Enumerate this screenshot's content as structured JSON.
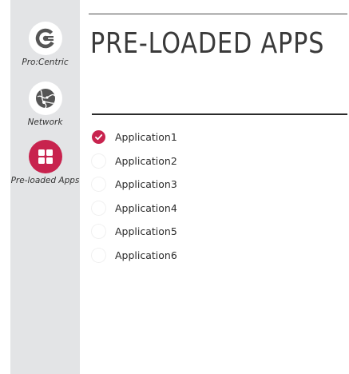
{
  "sidebar": {
    "items": [
      {
        "label": "Pro:Centric",
        "icon": "procentric-logo-icon",
        "color": "#ffffff"
      },
      {
        "label": "Network",
        "icon": "globe-icon",
        "color": "#ffffff"
      },
      {
        "label": "Pre-loaded Apps",
        "icon": "apps-grid-icon",
        "color": "#c8234e",
        "active": true
      }
    ]
  },
  "main": {
    "title": "PRE-LOADED APPS",
    "apps": [
      {
        "label": "Application1",
        "checked": true
      },
      {
        "label": "Application2",
        "checked": false
      },
      {
        "label": "Application3",
        "checked": false
      },
      {
        "label": "Application4",
        "checked": false
      },
      {
        "label": "Application5",
        "checked": false
      },
      {
        "label": "Application6",
        "checked": false
      }
    ]
  },
  "colors": {
    "accent": "#c8234e",
    "sidebar_bg": "#e3e4e6"
  }
}
